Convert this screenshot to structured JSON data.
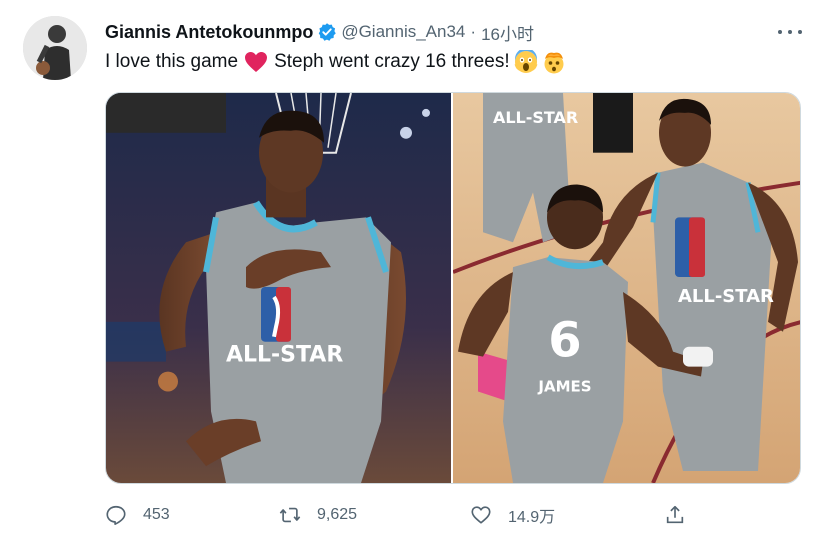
{
  "tweet": {
    "author_name": "Giannis Antetokounmpo",
    "handle": "@Giannis_An34",
    "separator": "·",
    "time": "16小时",
    "text_part1": "I love this game",
    "text_part2": "Steph went crazy  16 threes!",
    "emojis": [
      "red-heart",
      "screaming-face",
      "exploding-head"
    ],
    "photos": [
      {
        "jersey_text": "ALL-STAR"
      },
      {
        "jersey_number": "6",
        "jersey_name": "JAMES",
        "jersey_text": "ALL-STAR"
      }
    ]
  },
  "actions": {
    "reply_count": "453",
    "retweet_count": "9,625",
    "like_count": "14.9万",
    "share_label": ""
  },
  "colors": {
    "verified": "#1d9bf0",
    "text_secondary": "#536471",
    "jersey_silver": "#9aa0a3",
    "jersey_trim": "#4fb6d8",
    "heart": "#e0245e"
  }
}
